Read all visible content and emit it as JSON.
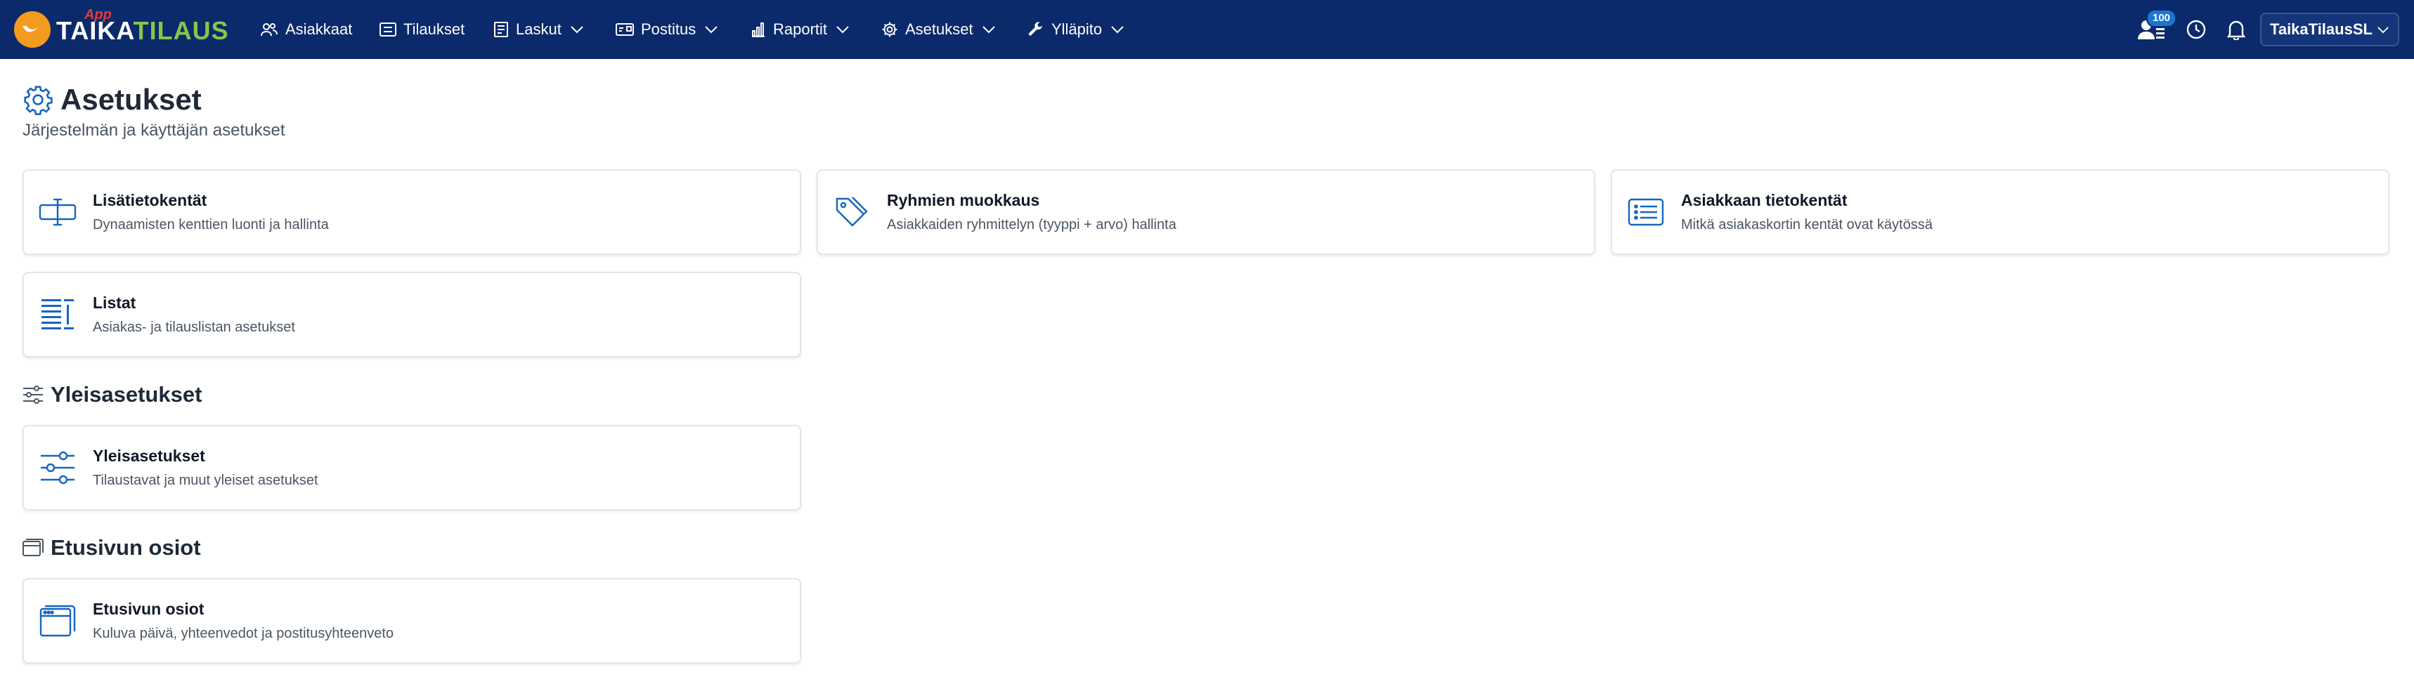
{
  "app": {
    "logo_word_1": "TAIKA",
    "logo_word_2": "TILAUS",
    "logo_app": "App",
    "brand_colors": {
      "navbar": "#0a2a6b",
      "accent": "#1565c0",
      "logo_orange": "#f39a1f",
      "logo_green": "#8bc34a"
    }
  },
  "nav": {
    "items": [
      {
        "label": "Asiakkaat",
        "icon": "users-icon",
        "dropdown": false
      },
      {
        "label": "Tilaukset",
        "icon": "list-box-icon",
        "dropdown": false
      },
      {
        "label": "Laskut",
        "icon": "invoice-icon",
        "dropdown": true
      },
      {
        "label": "Postitus",
        "icon": "mail-icon",
        "dropdown": true
      },
      {
        "label": "Raportit",
        "icon": "bar-chart-icon",
        "dropdown": true
      },
      {
        "label": "Asetukset",
        "icon": "gear-icon",
        "dropdown": true
      },
      {
        "label": "Ylläpito",
        "icon": "wrench-icon",
        "dropdown": true
      }
    ],
    "notifications_badge": "100",
    "user_label": "TaikaTilausSL"
  },
  "page": {
    "title": "Asetukset",
    "subtitle": "Järjestelmän ja käyttäjän asetukset"
  },
  "cards_main": [
    {
      "title": "Lisätietokentät",
      "desc": "Dynaamisten kenttien luonti ja hallinta",
      "icon": "input-field-icon"
    },
    {
      "title": "Ryhmien muokkaus",
      "desc": "Asiakkaiden ryhmittelyn (tyyppi + arvo) hallinta",
      "icon": "tag-icon"
    },
    {
      "title": "Asiakkaan tietokentät",
      "desc": "Mitkä asiakaskortin kentät ovat käytössä",
      "icon": "list-card-icon"
    },
    {
      "title": "Listat",
      "desc": "Asiakas- ja tilauslistan asetukset",
      "icon": "text-lines-icon"
    }
  ],
  "sections": [
    {
      "title": "Yleisasetukset",
      "icon": "sliders-icon",
      "cards": [
        {
          "title": "Yleisasetukset",
          "desc": "Tilaustavat ja muut yleiset asetukset",
          "icon": "sliders-icon"
        }
      ]
    },
    {
      "title": "Etusivun osiot",
      "icon": "browser-window-icon",
      "cards": [
        {
          "title": "Etusivun osiot",
          "desc": "Kuluva päivä, yhteenvedot ja postitusyhteenveto",
          "icon": "browser-window-icon"
        }
      ]
    }
  ]
}
